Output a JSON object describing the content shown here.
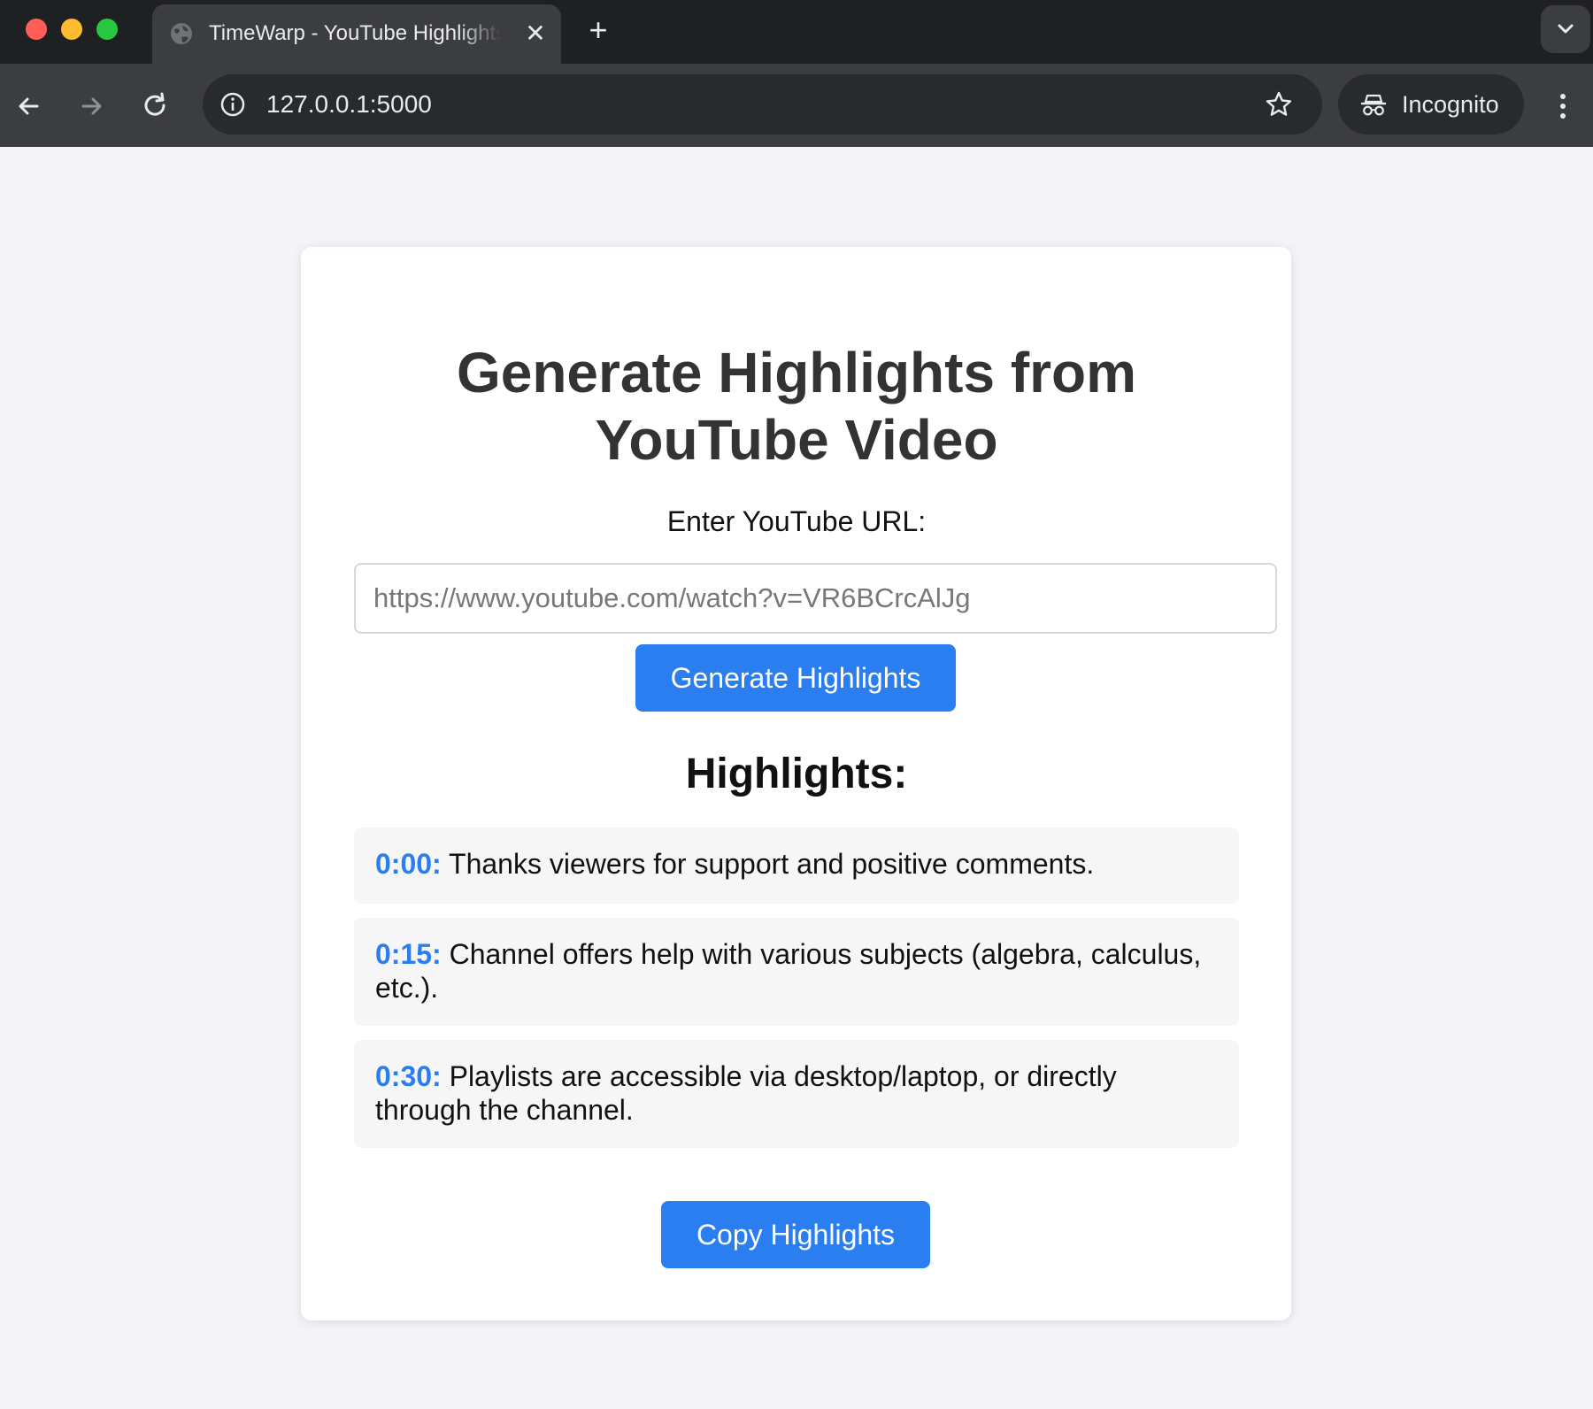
{
  "browser": {
    "tab_title": "TimeWarp - YouTube Highlights",
    "url": "127.0.0.1:5000",
    "incognito_label": "Incognito"
  },
  "page": {
    "heading": "Generate Highlights from YouTube Video",
    "url_label": "Enter YouTube URL:",
    "url_placeholder": "https://www.youtube.com/watch?v=VR6BCrcAlJg",
    "generate_button": "Generate Highlights",
    "highlights_heading": "Highlights:",
    "highlights": [
      {
        "timestamp": "0:00:",
        "text": " Thanks viewers for support and positive comments."
      },
      {
        "timestamp": "0:15:",
        "text": " Channel offers help with various subjects (algebra, calculus, etc.)."
      },
      {
        "timestamp": "0:30:",
        "text": " Playlists are accessible via desktop/laptop, or directly through the channel."
      }
    ],
    "copy_button": "Copy Highlights"
  },
  "colors": {
    "accent": "#2b7ef0",
    "heading": "#333333",
    "chrome_dark": "#1f2022",
    "chrome_toolbar": "#3c3d40"
  }
}
